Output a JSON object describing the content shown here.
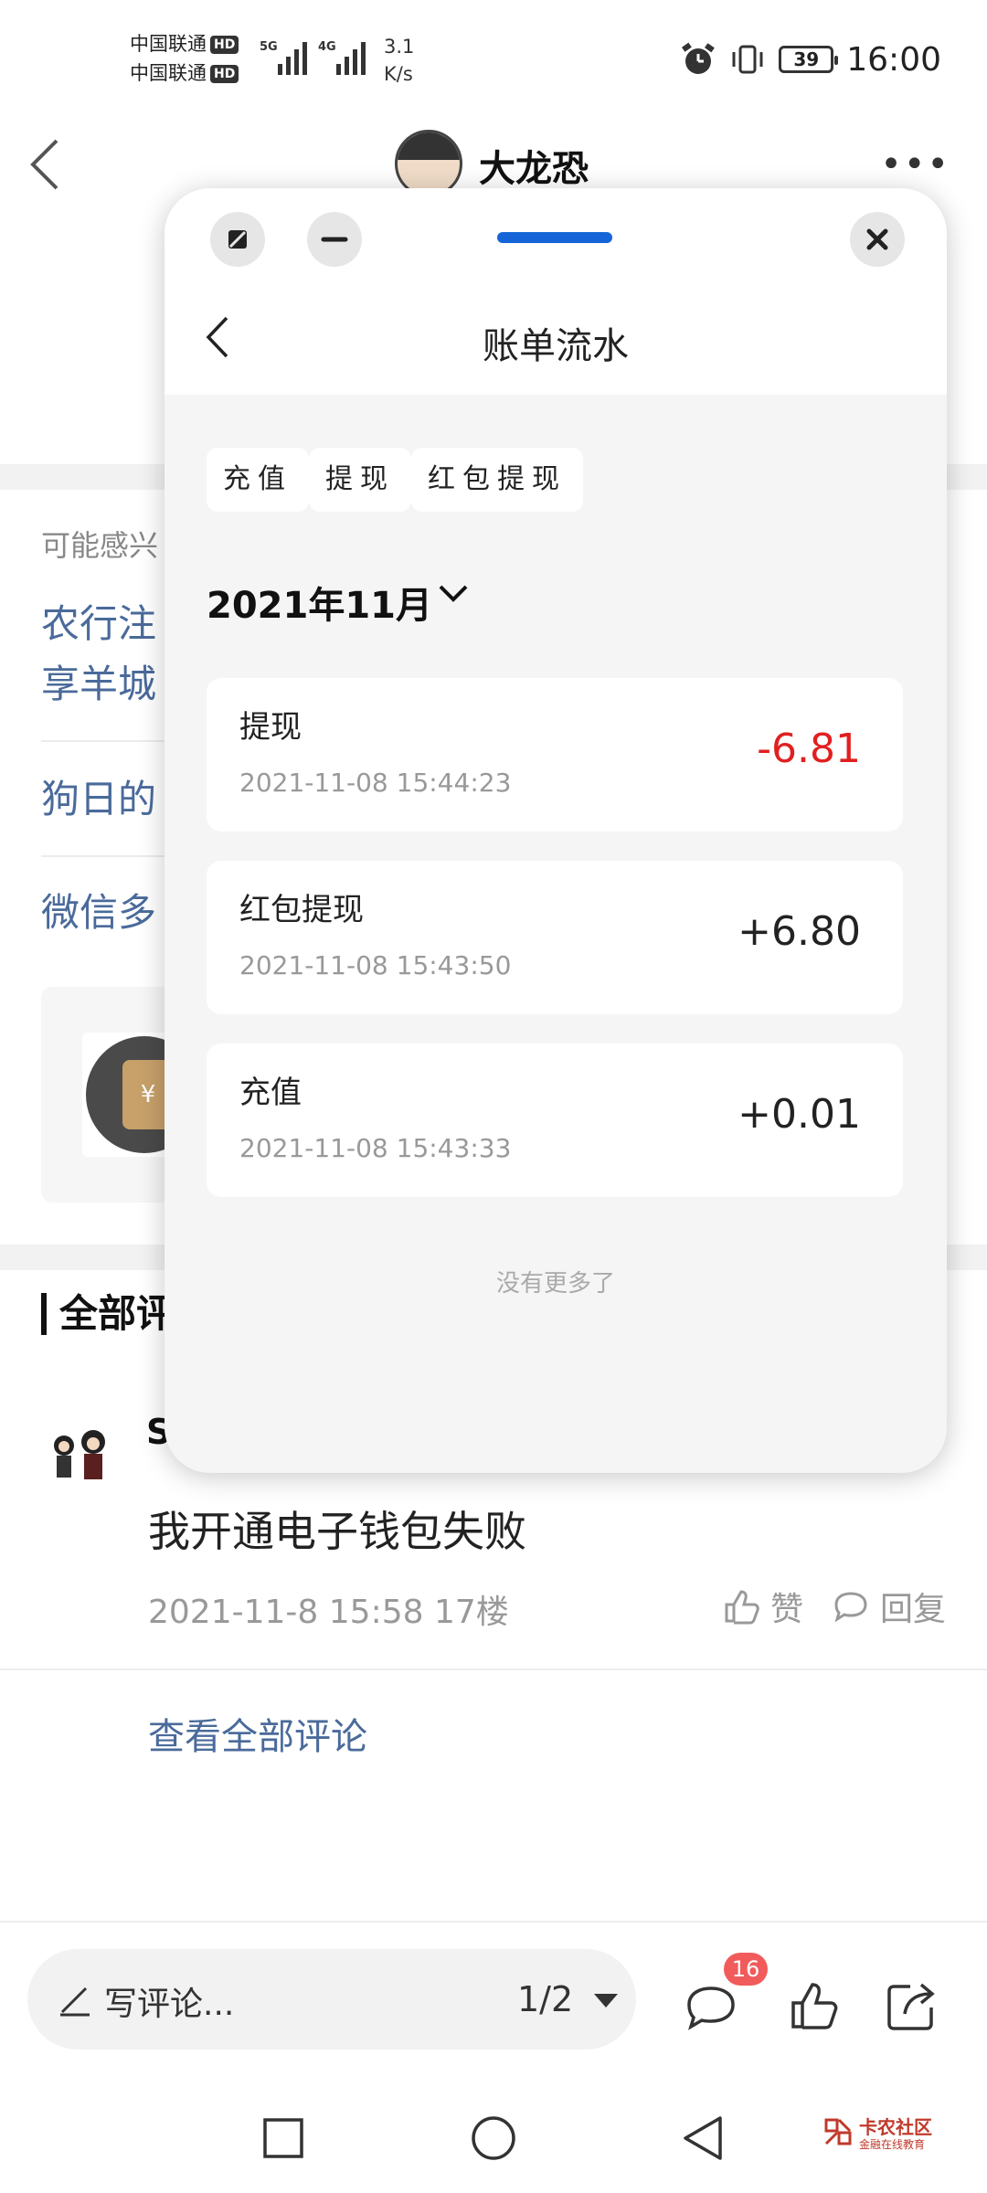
{
  "status_bar": {
    "carrier1": "中国联通",
    "carrier2": "中国联通",
    "hd_label": "HD",
    "net1": "5G",
    "net2": "4G",
    "speed_value": "3.1",
    "speed_unit": "K/s",
    "battery": "39",
    "time": "16:00"
  },
  "header": {
    "username": "大龙恐",
    "more_label": "•••"
  },
  "related": {
    "title": "可能感兴",
    "items": [
      "农行注",
      "享羊城",
      "狗日的",
      "微信多"
    ]
  },
  "card": {
    "thumb_glyph": "¥"
  },
  "comments": {
    "section_title": "全部评",
    "commenter": "S",
    "text": "我开通电子钱包失败",
    "meta": "2021-11-8 15:58  17楼",
    "like_label": "赞",
    "reply_label": "回复",
    "view_all": "查看全部评论"
  },
  "bottom_bar": {
    "write_placeholder": "写评论...",
    "page_indicator": "1/2",
    "comment_count": "16"
  },
  "watermark": {
    "main": "卡农社区",
    "sub": "金融在线教育"
  },
  "mini_window": {
    "title": "账单流水",
    "filters": [
      "充值",
      "提现",
      "红包提现"
    ],
    "month": "2021年11月",
    "transactions": [
      {
        "name": "提现",
        "time": "2021-11-08 15:44:23",
        "amount": "-6.81",
        "color": "#e02020"
      },
      {
        "name": "红包提现",
        "time": "2021-11-08 15:43:50",
        "amount": "+6.80",
        "color": "#222222"
      },
      {
        "name": "充值",
        "time": "2021-11-08 15:43:33",
        "amount": "+0.01",
        "color": "#222222"
      }
    ],
    "no_more": "没有更多了",
    "handle_color": "#1565d8"
  }
}
